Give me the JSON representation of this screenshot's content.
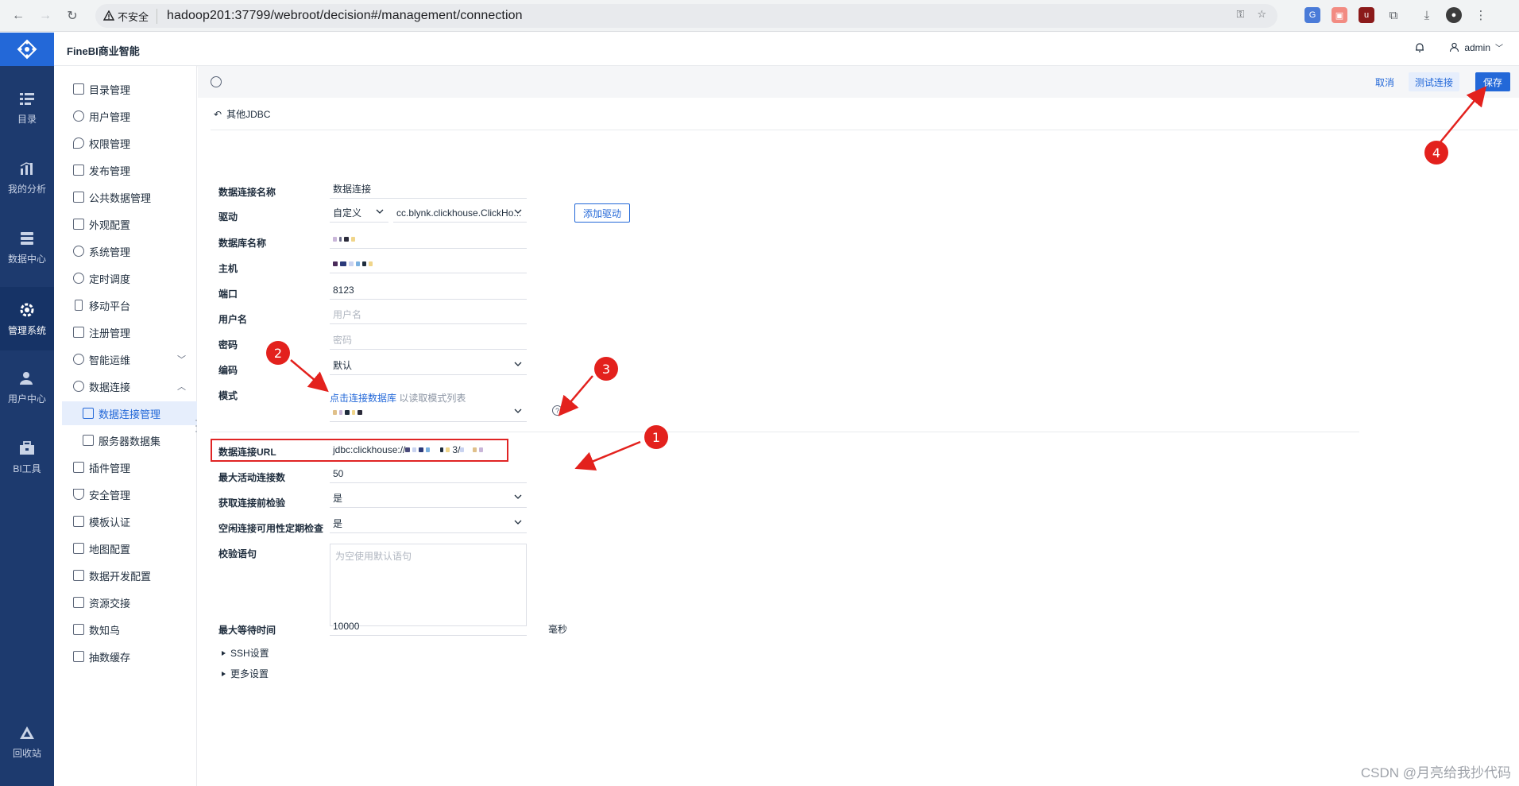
{
  "browser": {
    "security_label": "不安全",
    "url": "hadoop201:37799/webroot/decision#/management/connection"
  },
  "header": {
    "app_title": "FineBI商业智能",
    "user": "admin"
  },
  "leftnav": {
    "items": [
      {
        "label": "目录",
        "icon": "directory-icon"
      },
      {
        "label": "我的分析",
        "icon": "analysis-icon"
      },
      {
        "label": "数据中心",
        "icon": "data-center-icon"
      },
      {
        "label": "管理系统",
        "icon": "manage-icon",
        "active": true
      },
      {
        "label": "用户中心",
        "icon": "user-center-icon"
      },
      {
        "label": "BI工具",
        "icon": "toolbox-icon"
      }
    ],
    "recycle": "回收站"
  },
  "submenu": {
    "items": [
      "目录管理",
      "用户管理",
      "权限管理",
      "发布管理",
      "公共数据管理",
      "外观配置",
      "系统管理",
      "定时调度",
      "移动平台",
      "注册管理",
      "智能运维",
      "数据连接",
      "数据连接管理",
      "服务器数据集",
      "插件管理",
      "安全管理",
      "模板认证",
      "地图配置",
      "数据开发配置",
      "资源交接",
      "数知鸟",
      "抽数缓存"
    ]
  },
  "toolbar": {
    "cancel": "取消",
    "test": "测试连接",
    "save": "保存"
  },
  "breadcrumb": "其他JDBC",
  "form": {
    "name_label": "数据连接名称",
    "name_value": "数据连接",
    "driver_label": "驱动",
    "driver_type": "自定义",
    "driver_class": "cc.blynk.clickhouse.ClickHo...",
    "add_driver": "添加驱动",
    "db_label": "数据库名称",
    "host_label": "主机",
    "port_label": "端口",
    "port_value": "8123",
    "user_label": "用户名",
    "user_placeholder": "用户名",
    "pwd_label": "密码",
    "pwd_placeholder": "密码",
    "encoding_label": "编码",
    "encoding_value": "默认",
    "mode_label": "模式",
    "mode_link": "点击连接数据库",
    "mode_hint": "以读取模式列表",
    "url_label": "数据连接URL",
    "url_prefix": "jdbc:clickhouse://",
    "url_mid": "3/",
    "max_active_label": "最大活动连接数",
    "max_active_value": "50",
    "check_before_label": "获取连接前检验",
    "check_before_value": "是",
    "idle_check_label": "空闲连接可用性定期检查",
    "idle_check_value": "是",
    "validation_label": "校验语句",
    "validation_placeholder": "为空使用默认语句",
    "max_wait_label": "最大等待时间",
    "max_wait_value": "10000",
    "max_wait_unit": "毫秒",
    "ssh": "SSH设置",
    "more": "更多设置"
  },
  "annotations": [
    "1",
    "2",
    "3",
    "4"
  ],
  "watermark": "CSDN @月亮给我抄代码",
  "colors": {
    "brand": "#2368d8",
    "nav_bg": "#1d3a6e",
    "annotation": "#e3211d"
  }
}
